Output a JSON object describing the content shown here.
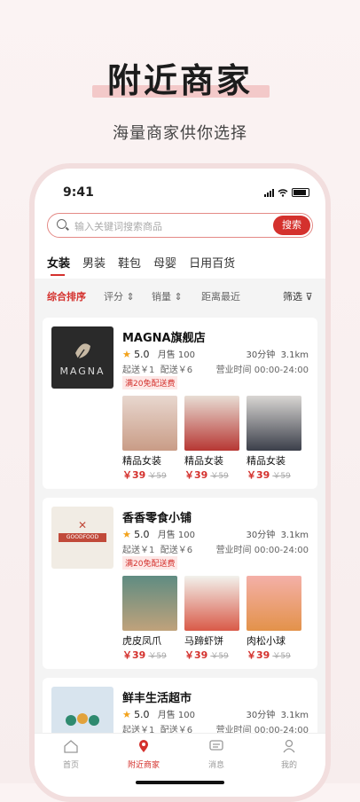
{
  "hero": {
    "title": "附近商家",
    "subtitle": "海量商家供你选择"
  },
  "status": {
    "time": "9:41"
  },
  "search": {
    "placeholder": "输入关键词搜索商品",
    "button": "搜索"
  },
  "categories": [
    "女装",
    "男装",
    "鞋包",
    "母婴",
    "日用百货"
  ],
  "sort": {
    "comprehensive": "综合排序",
    "rating": "评分",
    "sales": "销量",
    "distance": "距离最近",
    "filter": "筛选"
  },
  "stores": [
    {
      "name": "MAGNA旗舰店",
      "logo_text": "MAGNA",
      "rating": "5.0",
      "monthly": "月售 100",
      "time": "30分钟",
      "dist": "3.1km",
      "min": "起送￥1",
      "fee": "配送￥6",
      "hours": "营业时间 00:00-24:00",
      "promo": "满20免配送费",
      "products": [
        {
          "name": "精品女装",
          "price": "￥39",
          "old": "￥59"
        },
        {
          "name": "精品女装",
          "price": "￥39",
          "old": "￥59"
        },
        {
          "name": "精品女装",
          "price": "￥39",
          "old": "￥59"
        }
      ]
    },
    {
      "name": "香香零食小铺",
      "logo_text": "GOODFOOD",
      "rating": "5.0",
      "monthly": "月售 100",
      "time": "30分钟",
      "dist": "3.1km",
      "min": "起送￥1",
      "fee": "配送￥6",
      "hours": "营业时间 00:00-24:00",
      "promo": "满20免配送费",
      "products": [
        {
          "name": "虎皮凤爪",
          "price": "￥39",
          "old": "￥59"
        },
        {
          "name": "马蹄虾饼",
          "price": "￥39",
          "old": "￥59"
        },
        {
          "name": "肉松小球",
          "price": "￥39",
          "old": "￥59"
        }
      ]
    },
    {
      "name": "鲜丰生活超市",
      "rating": "5.0",
      "monthly": "月售 100",
      "time": "30分钟",
      "dist": "3.1km",
      "min": "起送￥1",
      "fee": "配送￥6",
      "hours": "营业时间 00:00-24:00"
    }
  ],
  "tabs": [
    "首页",
    "附近商家",
    "消息",
    "我的"
  ]
}
